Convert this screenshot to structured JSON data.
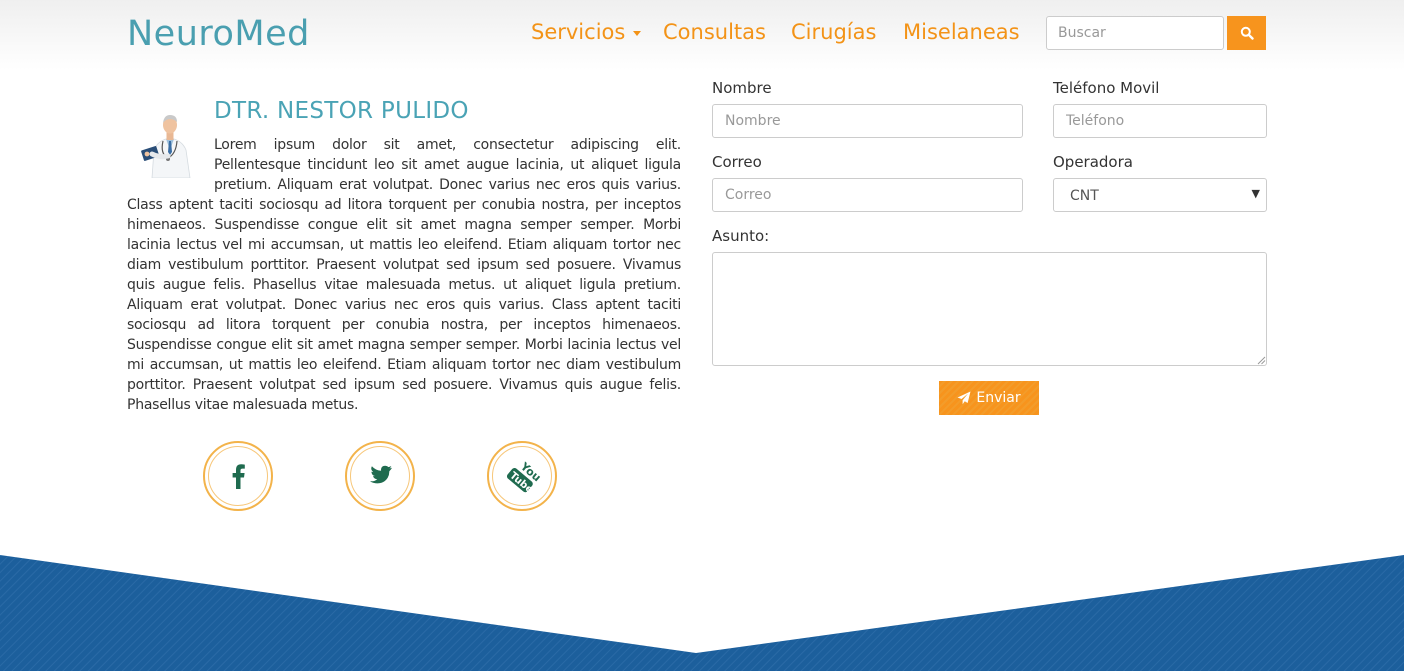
{
  "navbar": {
    "brand": "NeuroMed",
    "items": [
      {
        "label": "Servicios"
      },
      {
        "label": "Consultas"
      },
      {
        "label": "Cirugías"
      },
      {
        "label": "Miselaneas"
      }
    ],
    "search_placeholder": "Buscar",
    "search_icon": "search-icon"
  },
  "doctor": {
    "name": "DTR. NESTOR PULIDO",
    "bio": "Lorem ipsum dolor sit amet, consectetur adipiscing elit. Pellentesque tincidunt leo sit amet augue lacinia, ut aliquet ligula pretium. Aliquam erat volutpat. Donec varius nec eros quis varius. Class aptent taciti sociosqu ad litora torquent per conubia nostra, per inceptos himenaeos. Suspendisse congue elit sit amet magna semper semper. Morbi lacinia lectus vel mi accumsan, ut mattis leo eleifend. Etiam aliquam tortor nec diam vestibulum porttitor. Praesent volutpat sed ipsum sed posuere. Vivamus quis augue felis. Phasellus vitae malesuada metus. ut aliquet ligula pretium. Aliquam erat volutpat. Donec varius nec eros quis varius. Class aptent taciti sociosqu ad litora torquent per conubia nostra, per inceptos himenaeos. Suspendisse congue elit sit amet magna semper semper. Morbi lacinia lectus vel mi accumsan, ut mattis leo eleifend. Etiam aliquam tortor nec diam vestibulum porttitor. Praesent volutpat sed ipsum sed posuere. Vivamus quis augue felis. Phasellus vitae malesuada metus."
  },
  "social": [
    {
      "icon": "facebook-icon"
    },
    {
      "icon": "twitter-icon"
    },
    {
      "icon": "youtube-icon"
    }
  ],
  "form": {
    "nombre_label": "Nombre",
    "nombre_placeholder": "Nombre",
    "telefono_label": "Teléfono Movil",
    "telefono_placeholder": "Teléfono",
    "correo_label": "Correo",
    "correo_placeholder": "Correo",
    "operadora_label": "Operadora",
    "operadora_value": "CNT",
    "asunto_label": "Asunto:",
    "send_label": "Enviar",
    "send_icon": "paper-plane-icon"
  },
  "colors": {
    "brand": "#4a9fb0",
    "accent": "#f7941d",
    "footer": "#1c5f9c",
    "social_icon": "#1f6b4f"
  }
}
